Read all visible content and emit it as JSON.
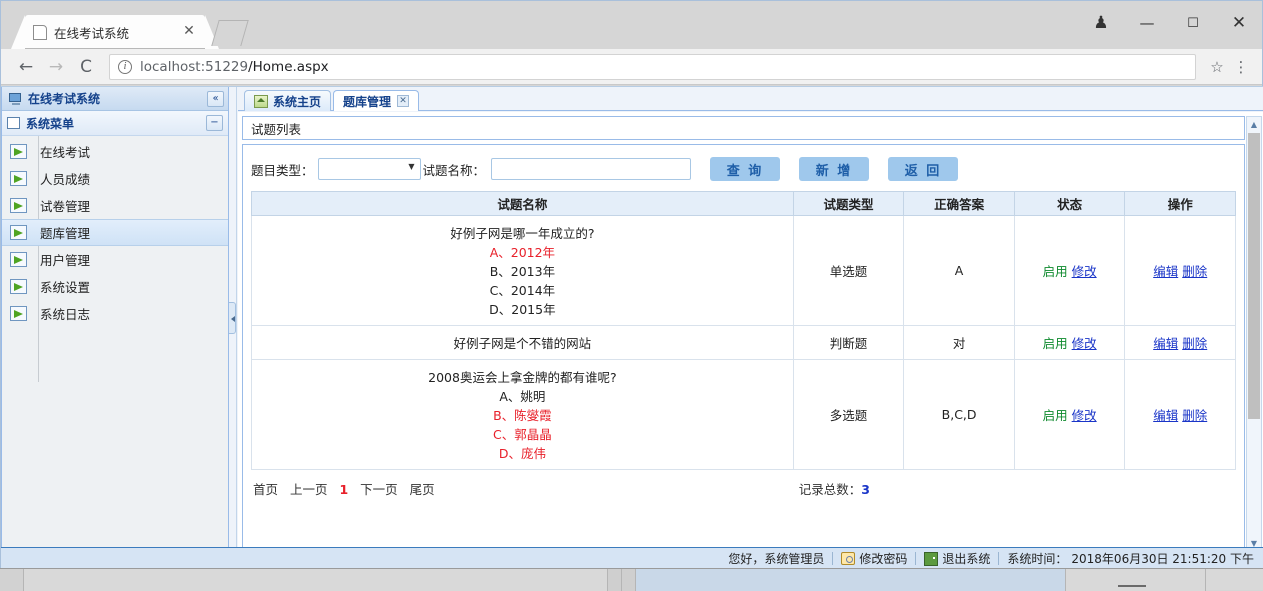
{
  "browser": {
    "tab": {
      "title": "在线考试系统",
      "close_label": "✕",
      "favicon": "page-icon"
    },
    "nav": {
      "back": "←",
      "forward": "→",
      "reload": "⟳"
    },
    "url": {
      "host": "localhost:51229",
      "path": "/Home.aspx",
      "info_icon": "ⓘ"
    },
    "star_icon": "☆",
    "menu_icon": "⋮",
    "window": {
      "profile": "person-icon",
      "minimize": "—",
      "maximize": "☐",
      "close": "✕"
    }
  },
  "sidebar": {
    "header_title": "在线考试系统",
    "collapse_label": "«",
    "group_title": "系统菜单",
    "group_collapse_label": "−",
    "items": [
      {
        "label": "在线考试",
        "active": false
      },
      {
        "label": "人员成绩",
        "active": false
      },
      {
        "label": "试卷管理",
        "active": false
      },
      {
        "label": "题库管理",
        "active": true
      },
      {
        "label": "用户管理",
        "active": false
      },
      {
        "label": "系统设置",
        "active": false
      },
      {
        "label": "系统日志",
        "active": false
      }
    ]
  },
  "content_tabs": [
    {
      "label": "系统主页",
      "active": false,
      "closable": false
    },
    {
      "label": "题库管理",
      "active": true,
      "closable": true,
      "close_label": "✕"
    }
  ],
  "panel": {
    "title": "试题列表",
    "toolbar": {
      "type_label": "题目类型：",
      "type_value": "",
      "name_label": "试题名称：",
      "name_value": "",
      "name_placeholder": "",
      "query_button": "查 询",
      "add_button": "新 增",
      "back_button": "返 回"
    },
    "grid": {
      "headers": [
        "试题名称",
        "试题类型",
        "正确答案",
        "状态",
        "操作"
      ],
      "rows": [
        {
          "question": "好例子网是哪一年成立的?",
          "options": [
            {
              "text": "A、2012年",
              "correct": true
            },
            {
              "text": "B、2013年",
              "correct": false
            },
            {
              "text": "C、2014年",
              "correct": false
            },
            {
              "text": "D、2015年",
              "correct": false
            }
          ],
          "type": "单选题",
          "answer": "A",
          "status": "启用",
          "status_action": "修改",
          "edit": "编辑",
          "delete": "删除"
        },
        {
          "question": "好例子网是个不错的网站",
          "options": [],
          "type": "判断题",
          "answer": "对",
          "status": "启用",
          "status_action": "修改",
          "edit": "编辑",
          "delete": "删除"
        },
        {
          "question": "2008奥运会上拿金牌的都有谁呢?",
          "options": [
            {
              "text": "A、姚明",
              "correct": false
            },
            {
              "text": "B、陈燮霞",
              "correct": true
            },
            {
              "text": "C、郭晶晶",
              "correct": true
            },
            {
              "text": "D、庞伟",
              "correct": true
            }
          ],
          "type": "多选题",
          "answer": "B,C,D",
          "status": "启用",
          "status_action": "修改",
          "edit": "编辑",
          "delete": "删除"
        }
      ]
    },
    "pager": {
      "first": "首页",
      "prev": "上一页",
      "current": "1",
      "next": "下一页",
      "last": "尾页",
      "total_label": "记录总数：",
      "total_value": "3"
    }
  },
  "statusbar": {
    "greeting": "您好，系统管理员",
    "change_password": "修改密码",
    "logout": "退出系统",
    "time_label": "系统时间：",
    "time_value": "2018年06月30日 21:51:20 下午"
  },
  "colors": {
    "accent": "#15428b",
    "button": "#9fc8ec",
    "button_text": "#1f5fa8",
    "link": "#1a35c8",
    "correct": "#e8202a",
    "status_on": "#0f8a2e"
  }
}
